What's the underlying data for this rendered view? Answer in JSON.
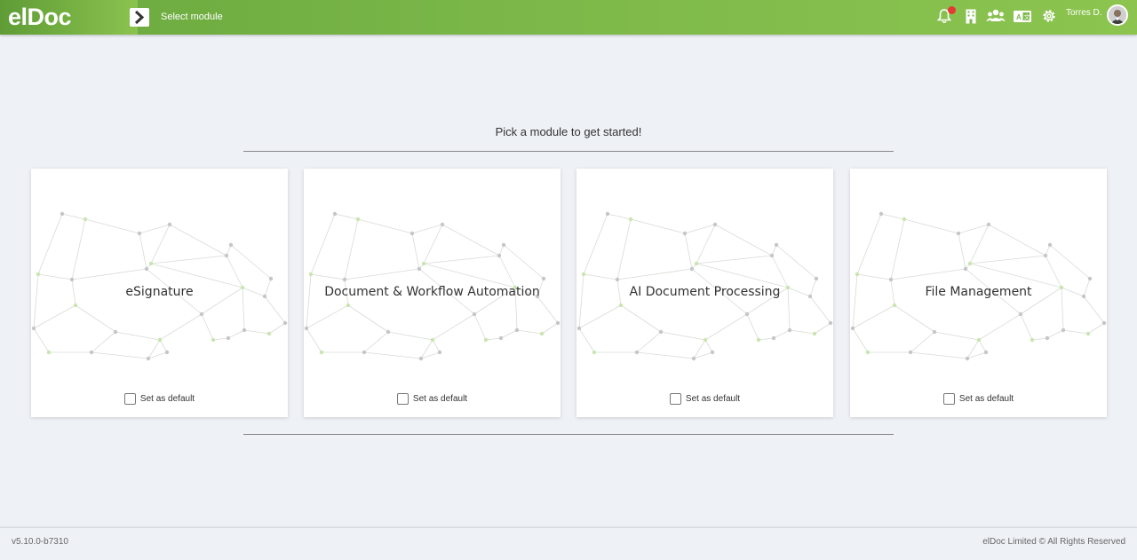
{
  "header": {
    "logo": "elDoc",
    "title": "Select module",
    "user_name": "Torres D."
  },
  "main": {
    "heading": "Pick a module to get started!",
    "modules": [
      {
        "title": "eSignature",
        "default_label": "Set as default"
      },
      {
        "title": "Document & Workflow Automation",
        "default_label": "Set as default"
      },
      {
        "title": "AI Document Processing",
        "default_label": "Set as default"
      },
      {
        "title": "File Management",
        "default_label": "Set as default"
      }
    ]
  },
  "footer": {
    "version": "v5.10.0-b7310",
    "copyright_owner": "elDoc Limited",
    "copyright_text": "All Rights Reserved"
  },
  "colors": {
    "accent": "#7db94a",
    "notification": "#e53935"
  }
}
